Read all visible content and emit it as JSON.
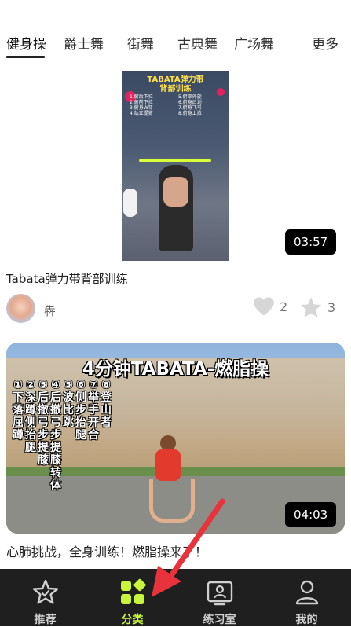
{
  "tabs": [
    {
      "label": "健身操",
      "active": true
    },
    {
      "label": "爵士舞",
      "active": false
    },
    {
      "label": "街舞",
      "active": false
    },
    {
      "label": "古典舞",
      "active": false
    },
    {
      "label": "广场舞",
      "active": false
    }
  ],
  "more_label": "更多",
  "card1": {
    "thumb_headline_1": "TABATA弹力带",
    "thumb_headline_2": "背部训练",
    "thumb_moves": [
      "1.俯后下拉",
      "2.俯前下拉",
      "3.俯身W弯",
      "4.站立提臂",
      "5.俯部外旋",
      "6.俯身后划",
      "7.俯身飞鸟",
      "8.俯身上拉"
    ],
    "duration": "03:57",
    "title": "Tabata弹力带背部训练",
    "author": "犇",
    "likes": "2",
    "favorites": "3"
  },
  "card2": {
    "thumb_headline": "4分钟TABATA-燃脂操",
    "thumb_moves": [
      "①下落屈蹲",
      "②深蹲侧抬腿",
      "③后撤弓步提膝",
      "④后撤弓步提膝转体",
      "⑤波比跳",
      "⑥侧步抬腿",
      "⑦举手开合",
      "⑧登山者"
    ],
    "duration": "04:03",
    "title": "心肺挑战，全身训练！燃脂操来了！"
  },
  "nav": [
    {
      "label": "推荐",
      "icon": "star-icon",
      "active": false
    },
    {
      "label": "分类",
      "icon": "category-grid-icon",
      "active": true
    },
    {
      "label": "练习室",
      "icon": "practice-room-icon",
      "active": false
    },
    {
      "label": "我的",
      "icon": "profile-icon",
      "active": false
    }
  ],
  "colors": {
    "accent": "#c8f53a",
    "nav_bg": "#1f1f1f",
    "arrow": "#e8323c"
  }
}
